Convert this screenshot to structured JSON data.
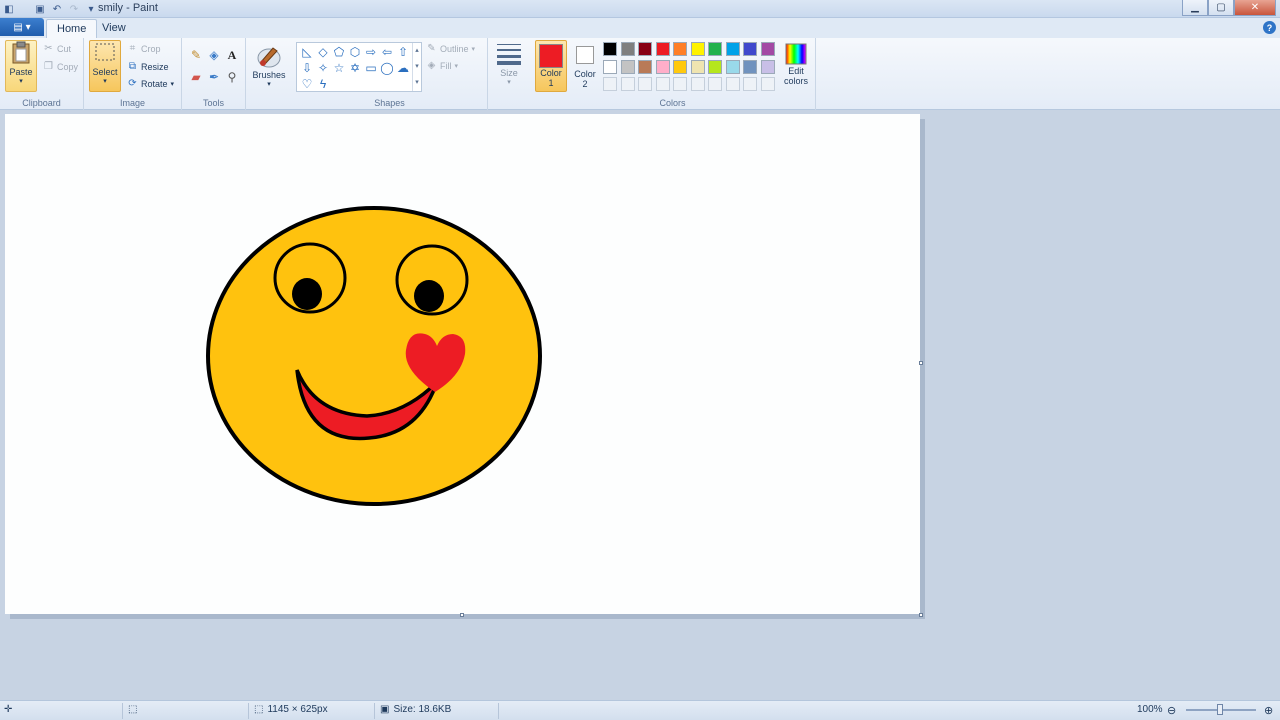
{
  "window": {
    "title": "smily - Paint"
  },
  "tabs": [
    "Home",
    "View"
  ],
  "clipboard": {
    "paste": "Paste",
    "cut": "Cut",
    "copy": "Copy",
    "label": "Clipboard"
  },
  "image": {
    "select": "Select",
    "crop": "Crop",
    "resize": "Resize",
    "rotate": "Rotate",
    "label": "Image"
  },
  "tools": {
    "label": "Tools"
  },
  "brushes": {
    "label": "Brushes"
  },
  "shapes": {
    "outline": "Outline",
    "fill": "Fill",
    "label": "Shapes"
  },
  "size": {
    "label": "Size"
  },
  "colors": {
    "color1_label": "Color",
    "color1_num": "1",
    "color2_label": "Color",
    "color2_num": "2",
    "edit_line1": "Edit",
    "edit_line2": "colors",
    "label": "Colors",
    "color1": "#ed1c24",
    "color2": "#ffffff",
    "palette": [
      "#000000",
      "#7f7f7f",
      "#880015",
      "#ed1c24",
      "#ff7f27",
      "#fff200",
      "#22b14c",
      "#00a2e8",
      "#3f48cc",
      "#a349a4",
      "#ffffff",
      "#c3c3c3",
      "#b97a57",
      "#ffaec9",
      "#ffc90e",
      "#efe4b0",
      "#b5e61d",
      "#99d9ea",
      "#7092be",
      "#c8bfe7"
    ]
  },
  "drawing": {
    "face_fill": "#ffc20e",
    "mouth_fill": "#ed1c24",
    "heart_fill": "#ed1c24",
    "outline": "#000000"
  },
  "status": {
    "dimensions": "1145 × 625px",
    "size": "Size: 18.6KB",
    "zoom": "100%"
  }
}
